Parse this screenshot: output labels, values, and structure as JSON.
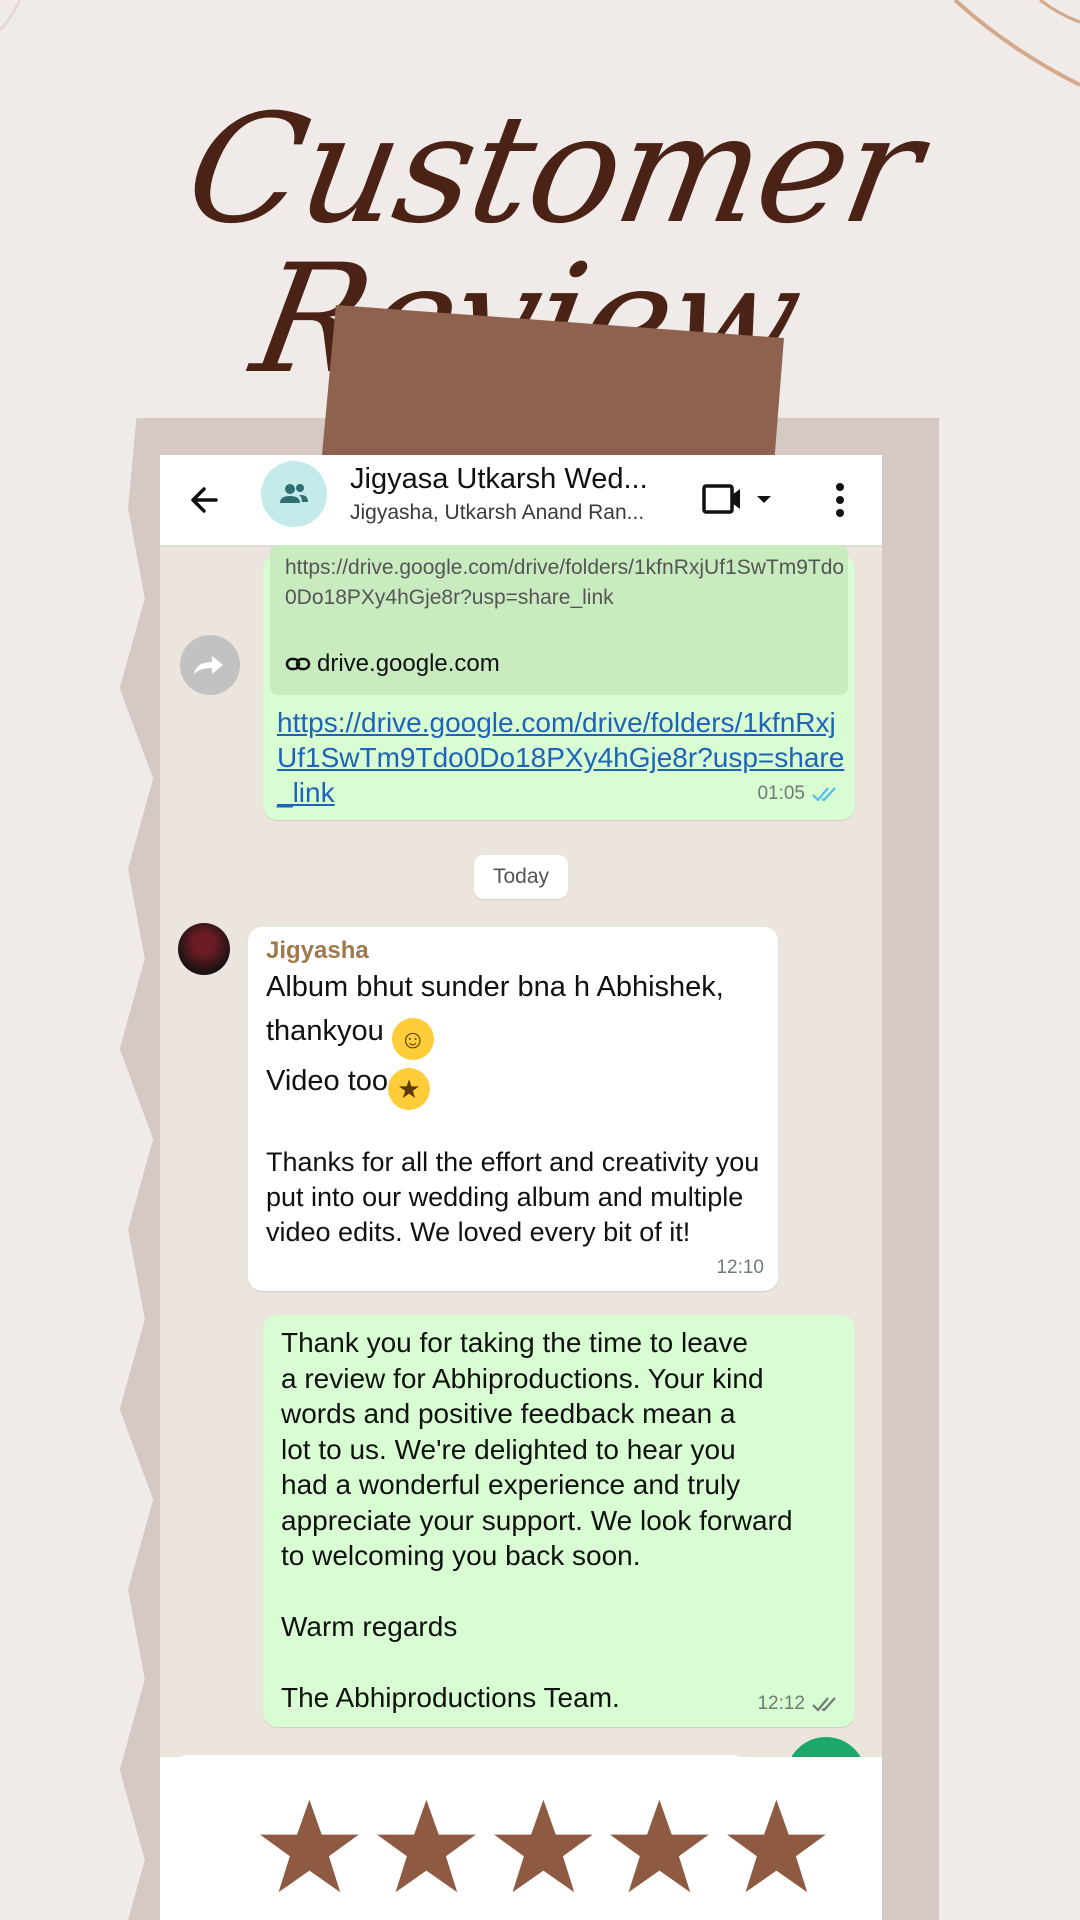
{
  "poster": {
    "headline": "Customer Review",
    "rating": 5,
    "colors": {
      "background": "#f0ebe8",
      "headline": "#4a2216",
      "tape": "#8f624f",
      "star": "#8f5a42"
    }
  },
  "chat": {
    "title": "Jigyasa Utkarsh Wed...",
    "subtitle": "Jigyasha, Utkarsh Anand Ran...",
    "icons": [
      "back-arrow-icon",
      "group-icon",
      "video-call-icon",
      "chevron-down-icon",
      "more-vert-icon",
      "forward-icon",
      "link-icon",
      "double-check-icon"
    ],
    "colors": {
      "outgoing": "#d9fdd3",
      "incoming": "#ffffff",
      "link": "#1e63b8",
      "sender": "#a1784b",
      "tick": "#53bdeb"
    }
  },
  "messages": {
    "quoted_url": "https://drive.google.com/drive/folders/1kfnRxjUf1SwTm9Tdo0Do18PXy4hGje8r?usp=share_link",
    "quoted_domain": "drive.google.com",
    "link_text": "https://drive.google.com/drive/folders/1kfnRxjUf1SwTm9Tdo0Do18PXy4hGje8r?usp=share_link",
    "link_time": "01:05",
    "date_divider": "Today",
    "incoming": {
      "sender": "Jigyasha",
      "line1": "Album bhut sunder bna h Abhishek,",
      "line2": "thankyou",
      "line3": "Video too",
      "paragraph": " Thanks for all the effort and creativity you put into our wedding album and multiple video edits. We loved every bit of it!",
      "time": "12:10"
    },
    "reply": {
      "text": "Thank you for taking the time to leave\na review for Abhiproductions. Your kind\nwords and positive feedback mean a\nlot to us. We're delighted to hear you\nhad a wonderful experience and truly\nappreciate your support. We look forward\nto welcoming you back soon.\n\nWarm regards\n\nThe Abhiproductions Team.",
      "time": "12:12"
    }
  }
}
